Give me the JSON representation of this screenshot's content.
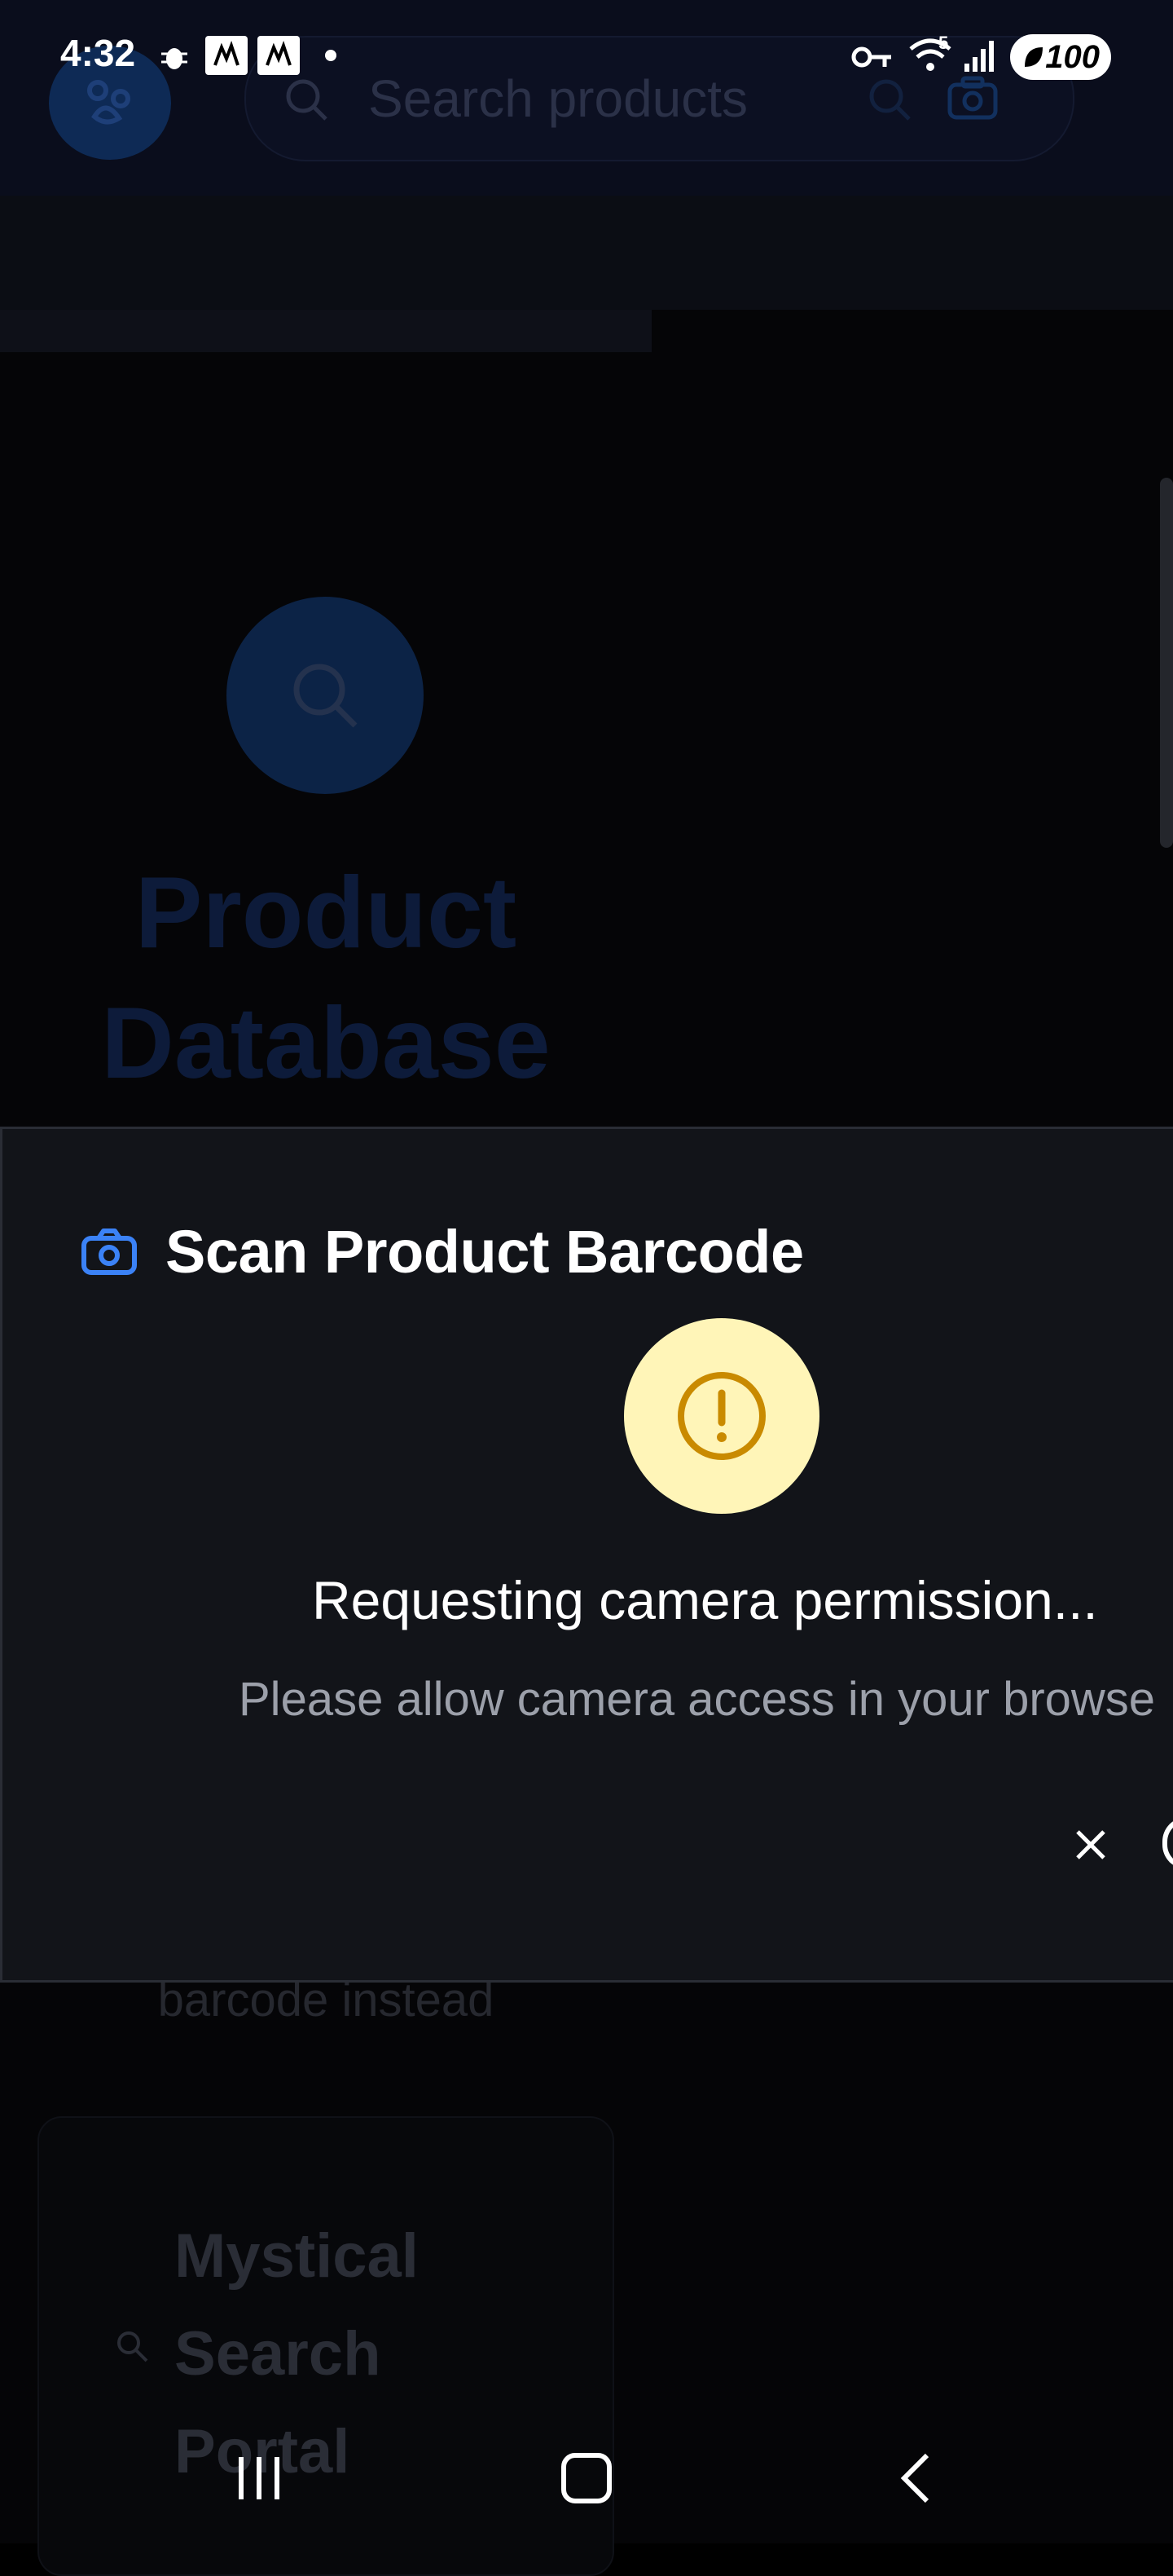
{
  "status_bar": {
    "time": "4:32",
    "battery": "100",
    "signal_label": "5"
  },
  "header": {
    "search_placeholder": "Search products"
  },
  "hero": {
    "title_line1": "Product",
    "title_line2": "Database",
    "subtitle_tail": "barcode instead"
  },
  "card": {
    "title": "Mystical Search Portal"
  },
  "modal": {
    "title": "Scan Product Barcode",
    "status": "Requesting camera permission...",
    "hint": "Please allow camera access in your browse"
  },
  "colors": {
    "accent": "#3b82f6",
    "warning_bg": "#fff5b8",
    "warning_icon": "#c98a00",
    "modal_bg": "#121419"
  }
}
